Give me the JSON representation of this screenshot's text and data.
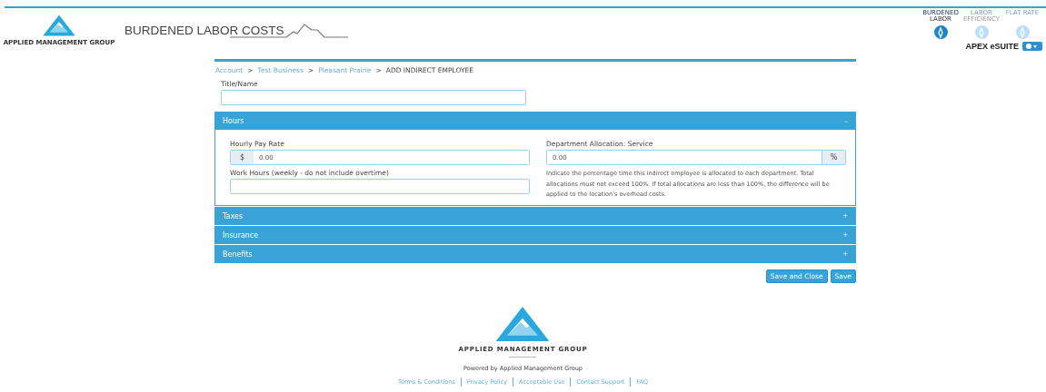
{
  "header": {
    "logo_text": "APPLIED MANAGEMENT GROUP",
    "title": "BURDENED LABOR COSTS",
    "apps": [
      {
        "label": "BURDENED LABOR",
        "selected": true
      },
      {
        "label": "LABOR EFFICIENCY",
        "selected": false
      },
      {
        "label": "FLAT RATE",
        "selected": false
      }
    ],
    "suite": "APEX eSUITE"
  },
  "breadcrumb": [
    {
      "label": "Account",
      "link": true
    },
    {
      "label": "Test Business",
      "link": true
    },
    {
      "label": "Pleasant Prairie",
      "link": true
    },
    {
      "label": "ADD INDIRECT EMPLOYEE",
      "link": false
    }
  ],
  "breadcrumb_separator": ">",
  "title_field": {
    "label": "Title/Name"
  },
  "sections": [
    {
      "title": "Hours",
      "expanded": true,
      "toggle": "–"
    },
    {
      "title": "Taxes",
      "expanded": false,
      "toggle": "+"
    },
    {
      "title": "Insurance",
      "expanded": false,
      "toggle": "+"
    },
    {
      "title": "Benefits",
      "expanded": false,
      "toggle": "+"
    }
  ],
  "hours": {
    "pay_rate": {
      "label": "Hourly Pay Rate",
      "prefix": "$",
      "value": "0.00"
    },
    "work_hours": {
      "label": "Work Hours (weekly - do not include overtime)"
    },
    "allocation": {
      "label": "Department Allocation: Service",
      "value": "0.00",
      "suffix": "%"
    },
    "help": "Indicate the percentage time this indirect employee is allocated to each department. Total allocations must not exceed 100%. If total allocations are less than 100%, the difference will be applied to the location's overhead costs."
  },
  "buttons": [
    "Save and Close",
    "Save"
  ],
  "footer": {
    "logo_text": "APPLIED MANAGEMENT GROUP",
    "powered": "Powered by Applied Management Group",
    "links": [
      "Terms & Conditions",
      "Privacy Policy",
      "Acceptable Use",
      "Contact Support",
      "FAQ"
    ]
  }
}
